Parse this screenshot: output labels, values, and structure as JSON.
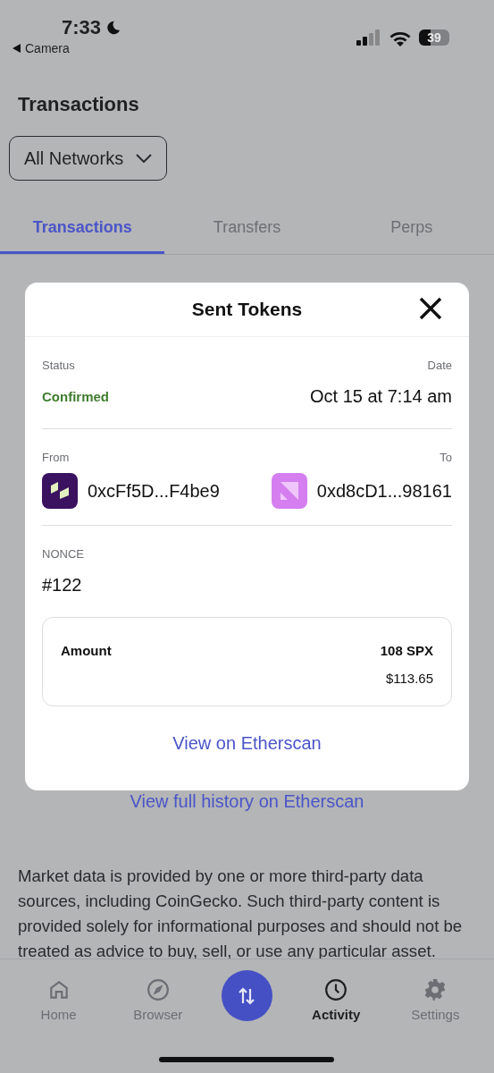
{
  "status_bar": {
    "time": "7:33",
    "back_label": "Camera",
    "battery": "39"
  },
  "header": {
    "title": "Transactions",
    "network_filter": "All Networks"
  },
  "tabs": [
    {
      "label": "Transactions",
      "selected": true
    },
    {
      "label": "Transfers",
      "selected": false
    },
    {
      "label": "Perps",
      "selected": false
    }
  ],
  "history_link": "View full history on Etherscan",
  "disclaimer": "Market data is provided by one or more third-party data sources, including CoinGecko. Such third-party content is provided solely for informational purposes and should not be treated as advice to buy, sell, or use any particular asset.",
  "bottom_nav": [
    {
      "label": "Home",
      "kind": "home",
      "selected": false
    },
    {
      "label": "Browser",
      "kind": "browser",
      "selected": false
    },
    {
      "kind": "swap",
      "selected": false
    },
    {
      "label": "Activity",
      "kind": "activity",
      "selected": true
    },
    {
      "label": "Settings",
      "kind": "settings",
      "selected": false
    }
  ],
  "modal": {
    "title": "Sent Tokens",
    "status": {
      "label": "Status",
      "value": "Confirmed",
      "kind": "confirmed"
    },
    "date": {
      "label": "Date",
      "value": "Oct 15 at 7:14 am"
    },
    "from": {
      "label": "From",
      "address": "0xcFf5D...F4be9"
    },
    "to": {
      "label": "To",
      "address": "0xd8cD1...98161"
    },
    "nonce": {
      "label": "NONCE",
      "value": "#122"
    },
    "amount": {
      "label": "Amount",
      "value": "108 SPX",
      "fiat": "$113.65"
    },
    "link": "View on Etherscan"
  }
}
